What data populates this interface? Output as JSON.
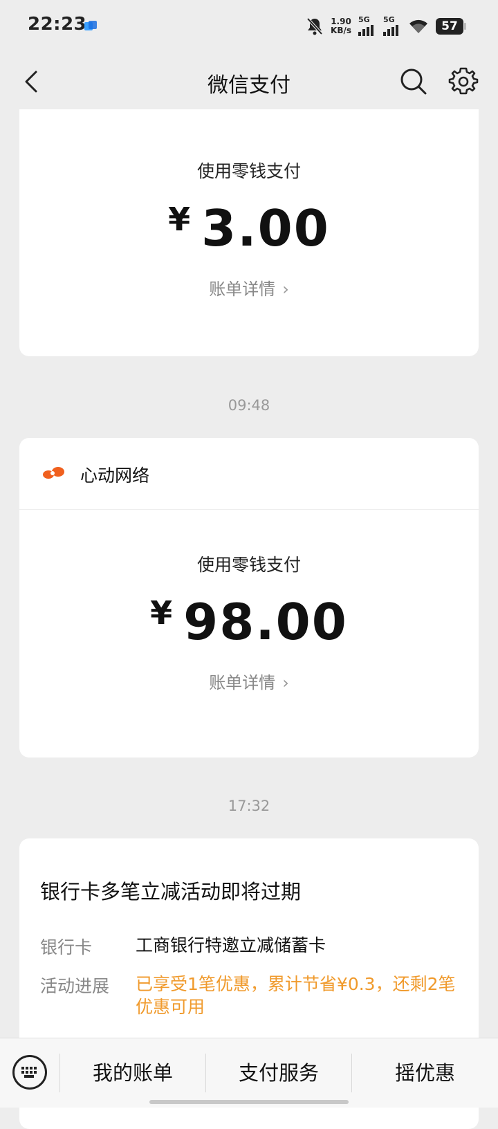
{
  "status_bar": {
    "time": "22:23",
    "net_speed_value": "1.90",
    "net_speed_unit": "KB/s",
    "signal_1_label": "5G",
    "signal_2_label": "5G",
    "battery": "57",
    "icons": [
      "app-notification-icon",
      "bell-muted-icon",
      "signal-icon",
      "wifi-icon",
      "battery-icon"
    ]
  },
  "nav": {
    "title": "微信支付",
    "icons": [
      "back-icon",
      "search-icon",
      "settings-icon"
    ]
  },
  "messages": [
    {
      "method": "使用零钱支付",
      "currency": "¥",
      "amount": "3.00",
      "detail_link": "账单详情"
    },
    {
      "time": "09:48",
      "merchant": "心动网络",
      "method": "使用零钱支付",
      "currency": "¥",
      "amount": "98.00",
      "detail_link": "账单详情"
    },
    {
      "time": "17:32",
      "title": "银行卡多笔立减活动即将过期",
      "rows": [
        {
          "key": "银行卡",
          "value": "工商银行特邀立减储蓄卡"
        },
        {
          "key": "活动进展",
          "value": "已享受1笔优惠，累计节省¥0.3，还剩2笔优惠可用"
        }
      ]
    }
  ],
  "bottom_bar": {
    "tabs": [
      "我的账单",
      "支付服务",
      "摇优惠"
    ]
  },
  "colors": {
    "background": "#ededed",
    "card": "#ffffff",
    "accent_orange": "#f09a2c",
    "merchant_logo": "#f0601e"
  }
}
